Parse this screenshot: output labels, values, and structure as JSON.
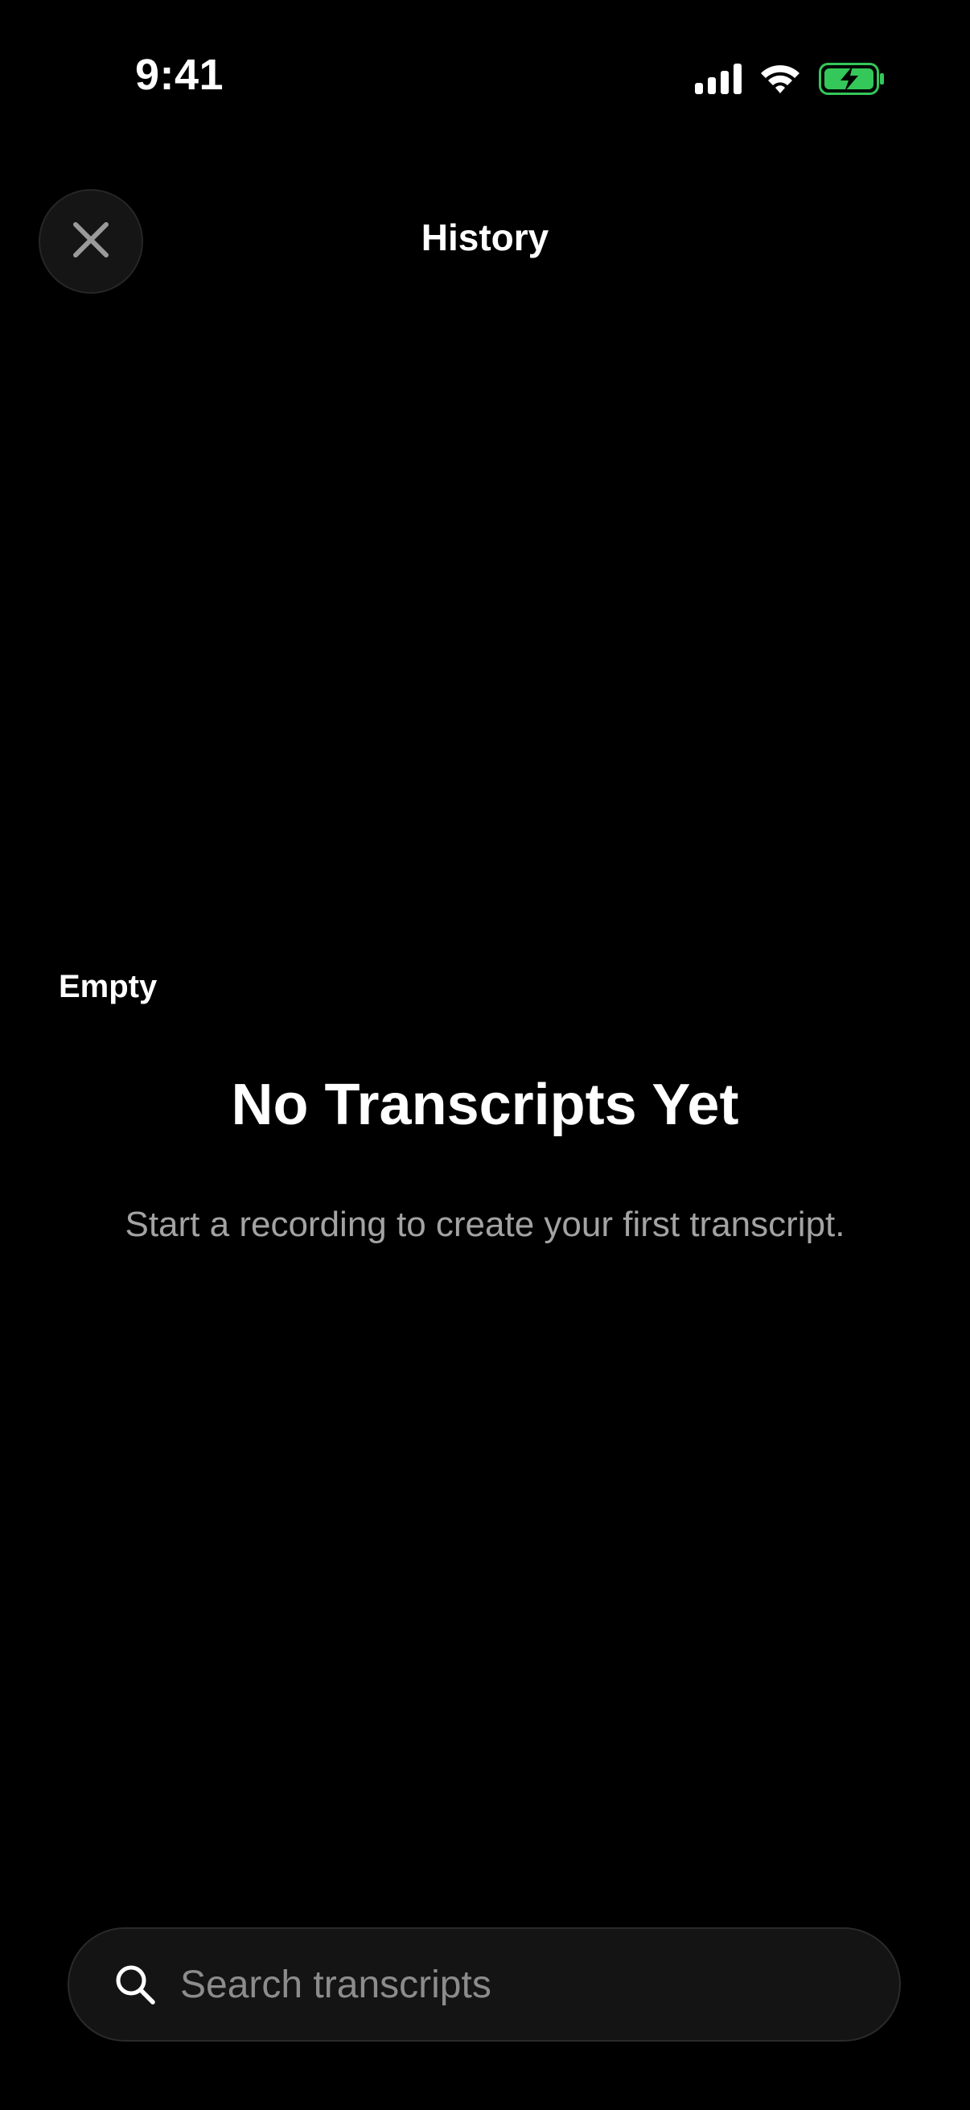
{
  "status_bar": {
    "time": "9:41",
    "icons": [
      "cellular-signal-icon",
      "wifi-icon",
      "battery-charging-icon"
    ],
    "battery_color": "#34c759"
  },
  "header": {
    "title": "History",
    "close_icon": "close-icon"
  },
  "empty_state": {
    "label": "Empty",
    "heading": "No Transcripts Yet",
    "message": "Start a recording to create your first transcript."
  },
  "search": {
    "icon": "search-icon",
    "placeholder": "Search transcripts",
    "value": ""
  },
  "colors": {
    "background": "#000000",
    "text_primary": "#ffffff",
    "text_secondary": "#a3a3a3",
    "surface": "#141414"
  }
}
